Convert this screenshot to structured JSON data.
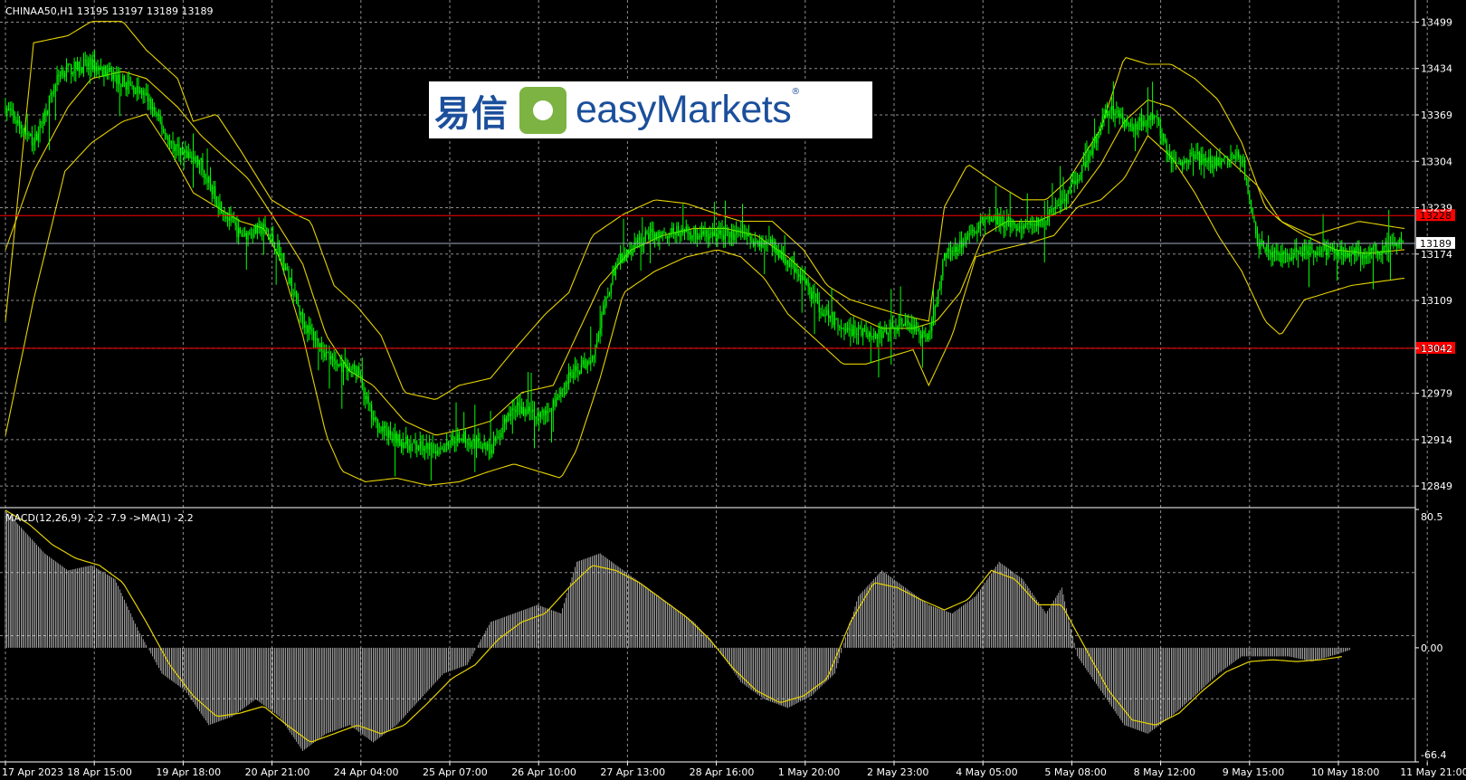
{
  "info": {
    "main_title": "CHINAA50,H1  13195 13197 13189 13189",
    "macd_title": "MACD(12,26,9) -2.2 -7.9  ->MA(1) -2.2"
  },
  "logo": {
    "cn": "易信",
    "en": "easyMarkets",
    "reg": "®"
  },
  "colors": {
    "background": "#000000",
    "grid": "#8c8c8c",
    "candle": "#00ff00",
    "bands": "#e6d200",
    "hist": "#ffffff",
    "signal": "#e6d200",
    "hline": "#ff0000",
    "current": "#a0b0c0"
  },
  "chart_data": [
    {
      "type": "candlestick",
      "symbol": "CHINAA50",
      "timeframe": "H1",
      "ylim": [
        12820,
        13530
      ],
      "y_ticks": [
        "13499",
        "13434",
        "13369",
        "13304",
        "13239",
        "13174",
        "13109",
        "13042",
        "12979",
        "12914",
        "12849"
      ],
      "x_ticks": [
        "17 Apr 2023",
        "18 Apr 15:00",
        "19 Apr 18:00",
        "20 Apr 21:00",
        "24 Apr 04:00",
        "25 Apr 07:00",
        "26 Apr 10:00",
        "27 Apr 13:00",
        "28 Apr 16:00",
        "1 May 20:00",
        "2 May 23:00",
        "4 May 05:00",
        "5 May 08:00",
        "8 May 12:00",
        "9 May 15:00",
        "10 May 18:00",
        "11 May 21:00"
      ],
      "price_path": [
        [
          0,
          13380
        ],
        [
          18,
          13330
        ],
        [
          35,
          13430
        ],
        [
          55,
          13440
        ],
        [
          75,
          13415
        ],
        [
          90,
          13395
        ],
        [
          105,
          13330
        ],
        [
          125,
          13300
        ],
        [
          135,
          13250
        ],
        [
          150,
          13200
        ],
        [
          165,
          13210
        ],
        [
          175,
          13180
        ],
        [
          190,
          13080
        ],
        [
          210,
          13020
        ],
        [
          225,
          13010
        ],
        [
          235,
          12940
        ],
        [
          245,
          12920
        ],
        [
          260,
          12905
        ],
        [
          275,
          12900
        ],
        [
          290,
          12920
        ],
        [
          310,
          12900
        ],
        [
          325,
          12960
        ],
        [
          345,
          12950
        ],
        [
          360,
          13000
        ],
        [
          375,
          13030
        ],
        [
          390,
          13160
        ],
        [
          410,
          13200
        ],
        [
          430,
          13205
        ],
        [
          450,
          13200
        ],
        [
          470,
          13200
        ],
        [
          490,
          13185
        ],
        [
          505,
          13155
        ],
        [
          520,
          13100
        ],
        [
          535,
          13070
        ],
        [
          555,
          13060
        ],
        [
          575,
          13080
        ],
        [
          590,
          13055
        ],
        [
          600,
          13170
        ],
        [
          615,
          13200
        ],
        [
          630,
          13225
        ],
        [
          650,
          13210
        ],
        [
          665,
          13220
        ],
        [
          675,
          13250
        ],
        [
          690,
          13300
        ],
        [
          705,
          13380
        ],
        [
          720,
          13350
        ],
        [
          735,
          13370
        ],
        [
          745,
          13300
        ],
        [
          760,
          13310
        ],
        [
          770,
          13300
        ],
        [
          790,
          13310
        ],
        [
          800,
          13190
        ],
        [
          815,
          13170
        ],
        [
          830,
          13180
        ],
        [
          850,
          13180
        ],
        [
          865,
          13175
        ],
        [
          875,
          13180
        ],
        [
          893,
          13190
        ]
      ],
      "bollinger_upper_path": [
        [
          0,
          13080
        ],
        [
          18,
          13470
        ],
        [
          40,
          13480
        ],
        [
          55,
          13500
        ],
        [
          75,
          13500
        ],
        [
          90,
          13460
        ],
        [
          110,
          13420
        ],
        [
          120,
          13360
        ],
        [
          135,
          13370
        ],
        [
          150,
          13320
        ],
        [
          170,
          13250
        ],
        [
          185,
          13230
        ],
        [
          195,
          13220
        ],
        [
          210,
          13130
        ],
        [
          225,
          13100
        ],
        [
          240,
          13060
        ],
        [
          255,
          12980
        ],
        [
          275,
          12970
        ],
        [
          290,
          12990
        ],
        [
          310,
          13000
        ],
        [
          325,
          13040
        ],
        [
          345,
          13090
        ],
        [
          360,
          13120
        ],
        [
          375,
          13200
        ],
        [
          395,
          13230
        ],
        [
          415,
          13250
        ],
        [
          435,
          13245
        ],
        [
          455,
          13230
        ],
        [
          470,
          13220
        ],
        [
          490,
          13220
        ],
        [
          510,
          13180
        ],
        [
          525,
          13130
        ],
        [
          540,
          13110
        ],
        [
          555,
          13100
        ],
        [
          570,
          13090
        ],
        [
          590,
          13080
        ],
        [
          600,
          13240
        ],
        [
          615,
          13300
        ],
        [
          635,
          13270
        ],
        [
          650,
          13250
        ],
        [
          665,
          13250
        ],
        [
          680,
          13280
        ],
        [
          700,
          13350
        ],
        [
          715,
          13450
        ],
        [
          730,
          13440
        ],
        [
          745,
          13440
        ],
        [
          760,
          13420
        ],
        [
          775,
          13390
        ],
        [
          790,
          13330
        ],
        [
          805,
          13240
        ],
        [
          815,
          13220
        ],
        [
          835,
          13200
        ],
        [
          865,
          13220
        ],
        [
          893,
          13210
        ]
      ],
      "bollinger_mid_path": [
        [
          0,
          13180
        ],
        [
          18,
          13290
        ],
        [
          40,
          13380
        ],
        [
          55,
          13420
        ],
        [
          75,
          13430
        ],
        [
          90,
          13420
        ],
        [
          110,
          13380
        ],
        [
          125,
          13340
        ],
        [
          140,
          13310
        ],
        [
          155,
          13280
        ],
        [
          170,
          13230
        ],
        [
          190,
          13160
        ],
        [
          205,
          13060
        ],
        [
          220,
          13010
        ],
        [
          235,
          12990
        ],
        [
          255,
          12940
        ],
        [
          275,
          12920
        ],
        [
          295,
          12930
        ],
        [
          310,
          12940
        ],
        [
          330,
          12980
        ],
        [
          350,
          12990
        ],
        [
          365,
          13060
        ],
        [
          380,
          13130
        ],
        [
          400,
          13180
        ],
        [
          420,
          13200
        ],
        [
          440,
          13210
        ],
        [
          460,
          13210
        ],
        [
          480,
          13200
        ],
        [
          500,
          13170
        ],
        [
          520,
          13130
        ],
        [
          540,
          13090
        ],
        [
          560,
          13070
        ],
        [
          580,
          13070
        ],
        [
          595,
          13080
        ],
        [
          610,
          13120
        ],
        [
          625,
          13200
        ],
        [
          640,
          13220
        ],
        [
          660,
          13220
        ],
        [
          680,
          13240
        ],
        [
          700,
          13300
        ],
        [
          715,
          13360
        ],
        [
          730,
          13390
        ],
        [
          745,
          13380
        ],
        [
          760,
          13350
        ],
        [
          780,
          13310
        ],
        [
          800,
          13270
        ],
        [
          815,
          13220
        ],
        [
          830,
          13200
        ],
        [
          850,
          13180
        ],
        [
          870,
          13175
        ],
        [
          893,
          13180
        ]
      ],
      "bollinger_lower_path": [
        [
          0,
          12920
        ],
        [
          18,
          13110
        ],
        [
          38,
          13290
        ],
        [
          55,
          13330
        ],
        [
          75,
          13360
        ],
        [
          90,
          13370
        ],
        [
          105,
          13320
        ],
        [
          120,
          13260
        ],
        [
          135,
          13240
        ],
        [
          150,
          13220
        ],
        [
          165,
          13210
        ],
        [
          175,
          13170
        ],
        [
          190,
          13060
        ],
        [
          205,
          12920
        ],
        [
          215,
          12870
        ],
        [
          230,
          12855
        ],
        [
          250,
          12860
        ],
        [
          270,
          12850
        ],
        [
          290,
          12855
        ],
        [
          310,
          12870
        ],
        [
          325,
          12880
        ],
        [
          340,
          12870
        ],
        [
          355,
          12860
        ],
        [
          365,
          12900
        ],
        [
          380,
          13000
        ],
        [
          395,
          13120
        ],
        [
          415,
          13150
        ],
        [
          435,
          13170
        ],
        [
          455,
          13180
        ],
        [
          470,
          13170
        ],
        [
          485,
          13140
        ],
        [
          500,
          13090
        ],
        [
          515,
          13060
        ],
        [
          535,
          13020
        ],
        [
          550,
          13020
        ],
        [
          565,
          13030
        ],
        [
          580,
          13040
        ],
        [
          590,
          12990
        ],
        [
          605,
          13060
        ],
        [
          620,
          13170
        ],
        [
          635,
          13180
        ],
        [
          655,
          13190
        ],
        [
          670,
          13200
        ],
        [
          685,
          13240
        ],
        [
          700,
          13250
        ],
        [
          715,
          13280
        ],
        [
          730,
          13340
        ],
        [
          745,
          13310
        ],
        [
          760,
          13260
        ],
        [
          775,
          13200
        ],
        [
          790,
          13150
        ],
        [
          805,
          13080
        ],
        [
          815,
          13060
        ],
        [
          830,
          13110
        ],
        [
          860,
          13130
        ],
        [
          893,
          13140
        ]
      ],
      "horizontal_lines": [
        {
          "value": 13228,
          "label": "13228"
        },
        {
          "value": 13042,
          "label": "13042"
        }
      ],
      "current_price": {
        "value": 13189,
        "label": "13189"
      }
    },
    {
      "type": "macd",
      "params": "MACD(12,26,9)",
      "values": {
        "macd": -2.2,
        "signal": -7.9,
        "ma": -2.2
      },
      "ylim": [
        -66.4,
        80.5
      ],
      "y_ticks": [
        "80.5",
        "0.00",
        "-66.4"
      ],
      "hist_path": [
        [
          0,
          80
        ],
        [
          10,
          70
        ],
        [
          25,
          55
        ],
        [
          40,
          45
        ],
        [
          55,
          48
        ],
        [
          70,
          40
        ],
        [
          85,
          10
        ],
        [
          100,
          -15
        ],
        [
          115,
          -25
        ],
        [
          130,
          -45
        ],
        [
          145,
          -40
        ],
        [
          160,
          -30
        ],
        [
          175,
          -40
        ],
        [
          190,
          -60
        ],
        [
          205,
          -50
        ],
        [
          220,
          -45
        ],
        [
          235,
          -55
        ],
        [
          250,
          -45
        ],
        [
          265,
          -30
        ],
        [
          280,
          -15
        ],
        [
          295,
          -10
        ],
        [
          310,
          15
        ],
        [
          325,
          20
        ],
        [
          340,
          25
        ],
        [
          355,
          20
        ],
        [
          365,
          50
        ],
        [
          380,
          55
        ],
        [
          395,
          45
        ],
        [
          410,
          35
        ],
        [
          425,
          25
        ],
        [
          440,
          15
        ],
        [
          455,
          0
        ],
        [
          470,
          -20
        ],
        [
          485,
          -30
        ],
        [
          500,
          -35
        ],
        [
          515,
          -28
        ],
        [
          530,
          -15
        ],
        [
          545,
          30
        ],
        [
          560,
          45
        ],
        [
          575,
          35
        ],
        [
          590,
          25
        ],
        [
          605,
          20
        ],
        [
          620,
          30
        ],
        [
          635,
          50
        ],
        [
          650,
          40
        ],
        [
          665,
          20
        ],
        [
          675,
          35
        ],
        [
          685,
          -5
        ],
        [
          700,
          -25
        ],
        [
          715,
          -45
        ],
        [
          730,
          -50
        ],
        [
          745,
          -40
        ],
        [
          760,
          -28
        ],
        [
          775,
          -15
        ],
        [
          790,
          -5
        ],
        [
          805,
          -5
        ],
        [
          820,
          -5
        ],
        [
          835,
          -8
        ],
        [
          850,
          -4
        ],
        [
          860,
          -1
        ]
      ],
      "signal_path": [
        [
          0,
          80
        ],
        [
          15,
          72
        ],
        [
          30,
          60
        ],
        [
          45,
          52
        ],
        [
          60,
          48
        ],
        [
          75,
          38
        ],
        [
          90,
          15
        ],
        [
          105,
          -10
        ],
        [
          120,
          -28
        ],
        [
          135,
          -40
        ],
        [
          150,
          -38
        ],
        [
          165,
          -34
        ],
        [
          180,
          -45
        ],
        [
          195,
          -55
        ],
        [
          210,
          -50
        ],
        [
          225,
          -45
        ],
        [
          240,
          -50
        ],
        [
          255,
          -45
        ],
        [
          270,
          -32
        ],
        [
          285,
          -18
        ],
        [
          300,
          -10
        ],
        [
          315,
          5
        ],
        [
          330,
          15
        ],
        [
          345,
          20
        ],
        [
          360,
          35
        ],
        [
          375,
          48
        ],
        [
          390,
          45
        ],
        [
          405,
          38
        ],
        [
          420,
          28
        ],
        [
          435,
          18
        ],
        [
          450,
          5
        ],
        [
          465,
          -12
        ],
        [
          480,
          -25
        ],
        [
          495,
          -32
        ],
        [
          510,
          -28
        ],
        [
          525,
          -18
        ],
        [
          540,
          15
        ],
        [
          555,
          38
        ],
        [
          570,
          35
        ],
        [
          585,
          28
        ],
        [
          600,
          22
        ],
        [
          615,
          28
        ],
        [
          630,
          45
        ],
        [
          645,
          40
        ],
        [
          660,
          25
        ],
        [
          675,
          25
        ],
        [
          690,
          0
        ],
        [
          705,
          -25
        ],
        [
          720,
          -42
        ],
        [
          735,
          -45
        ],
        [
          750,
          -38
        ],
        [
          765,
          -25
        ],
        [
          780,
          -14
        ],
        [
          795,
          -8
        ],
        [
          810,
          -7
        ],
        [
          825,
          -8
        ],
        [
          840,
          -7
        ],
        [
          855,
          -5
        ]
      ]
    }
  ]
}
